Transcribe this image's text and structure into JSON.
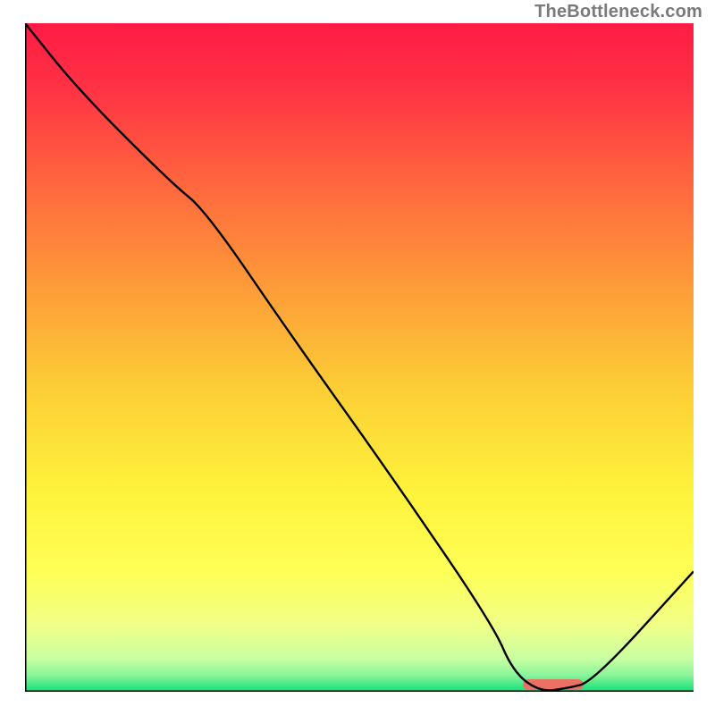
{
  "attribution": "TheBottleneck.com",
  "chart_data": {
    "type": "line",
    "title": "",
    "xlabel": "",
    "ylabel": "",
    "xlim": [
      0,
      100
    ],
    "ylim": [
      0,
      100
    ],
    "grid": false,
    "legend": false,
    "series": [
      {
        "name": "curve",
        "x": [
          0,
          8,
          22,
          27,
          40,
          55,
          70,
          73,
          77,
          81,
          85,
          100
        ],
        "y": [
          100,
          90,
          76,
          72,
          53,
          32,
          10,
          3,
          0,
          0.5,
          1.5,
          18
        ]
      }
    ],
    "marker": {
      "name": "optimal-marker",
      "x_center": 79,
      "width_pct": 9,
      "color": "#ec7063"
    },
    "gradient_stops": [
      {
        "offset": 0.0,
        "color": "#ff1c45"
      },
      {
        "offset": 0.1,
        "color": "#ff3344"
      },
      {
        "offset": 0.25,
        "color": "#ff6a3e"
      },
      {
        "offset": 0.4,
        "color": "#fd9d38"
      },
      {
        "offset": 0.55,
        "color": "#fccf36"
      },
      {
        "offset": 0.7,
        "color": "#fef23b"
      },
      {
        "offset": 0.82,
        "color": "#feff56"
      },
      {
        "offset": 0.9,
        "color": "#f1ff87"
      },
      {
        "offset": 0.95,
        "color": "#c9ffa2"
      },
      {
        "offset": 0.975,
        "color": "#8bf59a"
      },
      {
        "offset": 0.995,
        "color": "#28e47f"
      },
      {
        "offset": 1.0,
        "color": "#15da76"
      }
    ],
    "axis_color": "#000000",
    "line_color": "#000000",
    "line_width": 2.4,
    "marker_height_px": 12,
    "marker_radius_px": 6
  }
}
